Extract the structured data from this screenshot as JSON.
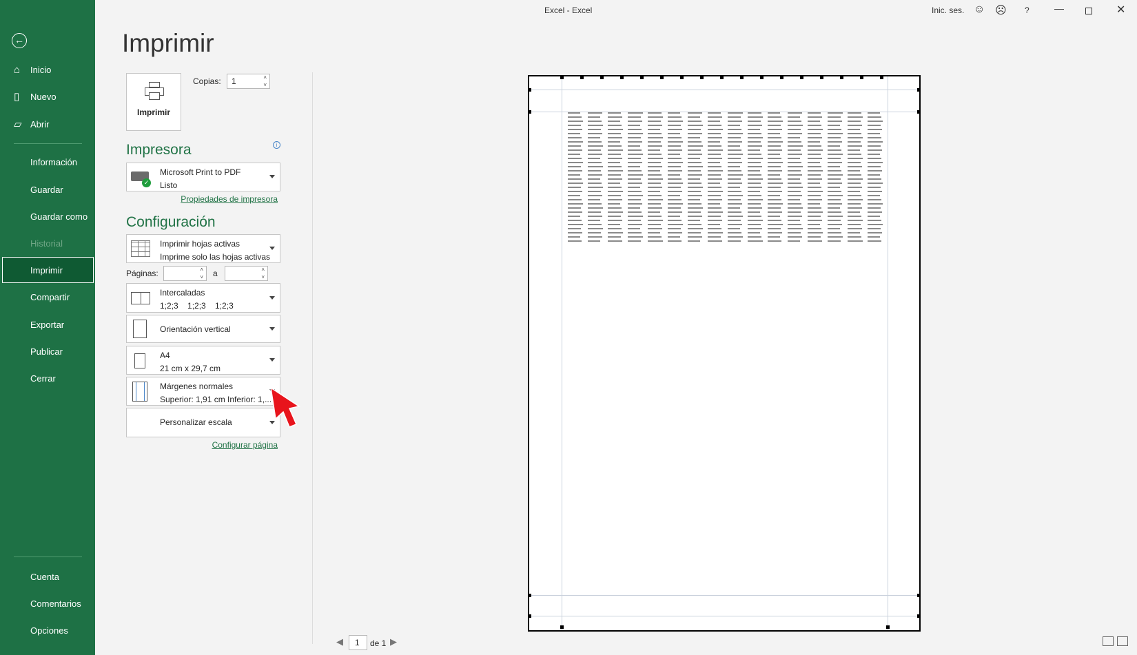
{
  "titlebar": {
    "title": "Excel - Excel",
    "signin": "Inic. ses.",
    "help": "?"
  },
  "sidebar": {
    "top": [
      {
        "label": "Inicio",
        "icon": "home-icon"
      },
      {
        "label": "Nuevo",
        "icon": "new-file-icon"
      },
      {
        "label": "Abrir",
        "icon": "folder-open-icon"
      }
    ],
    "middle": [
      "Información",
      "Guardar",
      "Guardar como",
      "Historial",
      "Imprimir",
      "Compartir",
      "Exportar",
      "Publicar",
      "Cerrar"
    ],
    "bottom": [
      "Cuenta",
      "Comentarios",
      "Opciones"
    ]
  },
  "print": {
    "title": "Imprimir",
    "button": "Imprimir",
    "copies_label": "Copias:",
    "copies": "1",
    "printer_heading": "Impresora",
    "printer_name": "Microsoft Print to PDF",
    "printer_status": "Listo",
    "printer_props": "Propiedades de impresora",
    "config_heading": "Configuración",
    "scope": {
      "l1": "Imprimir hojas activas",
      "l2": "Imprime solo las hojas activas"
    },
    "pages_label": "Páginas:",
    "pages_to": "a",
    "pages_from_value": "",
    "pages_to_value": "",
    "collate": {
      "l1": "Intercaladas",
      "l2": "1;2;3    1;2;3    1;2;3"
    },
    "orientation": "Orientación vertical",
    "paper": {
      "l1": "A4",
      "l2": "21 cm x 29,7 cm"
    },
    "margins": {
      "l1": "Márgenes normales",
      "l2": "Superior: 1,91 cm Inferior: 1,..."
    },
    "scale": "Personalizar escala",
    "page_setup": "Configurar página"
  },
  "preview": {
    "current_page": "1",
    "of": "de 1"
  }
}
